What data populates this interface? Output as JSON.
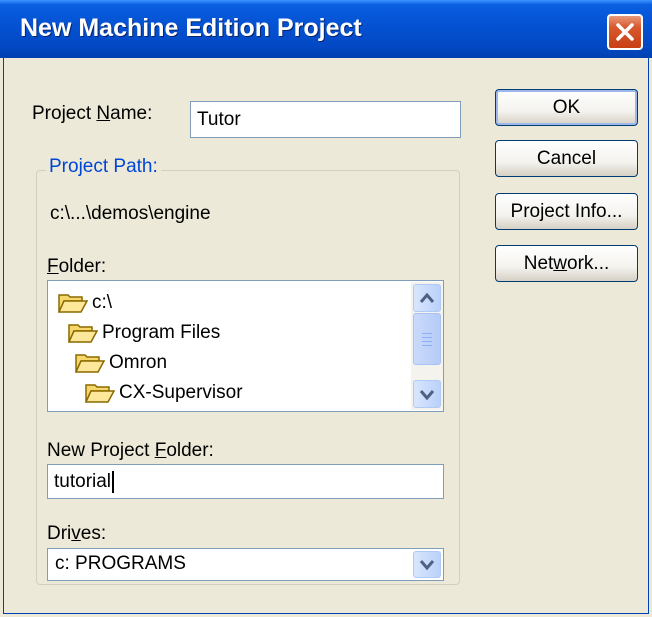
{
  "window": {
    "title": "New Machine Edition Project"
  },
  "project_name": {
    "label_before": "Project ",
    "label_mnemonic": "N",
    "label_after": "ame:",
    "value": "Tutor"
  },
  "project_path": {
    "group_label": "Project Path:",
    "path": "c:\\...\\demos\\engine"
  },
  "folder": {
    "label_mnemonic": "F",
    "label_after": "older:",
    "items": [
      {
        "label": "c:\\",
        "icon": "open-folder-icon"
      },
      {
        "label": "Program Files",
        "icon": "open-folder-icon"
      },
      {
        "label": "Omron",
        "icon": "open-folder-icon"
      },
      {
        "label": "CX-Supervisor",
        "icon": "open-folder-icon"
      }
    ]
  },
  "new_project_folder": {
    "label_before": "New Project ",
    "label_mnemonic": "F",
    "label_after": "older:",
    "value": "tutorial"
  },
  "drives": {
    "label_before": "Dri",
    "label_mnemonic": "v",
    "label_after": "es:",
    "selected": "c: PROGRAMS"
  },
  "buttons": {
    "ok": "OK",
    "cancel": "Cancel",
    "project_info": "Project Info...",
    "network_before": "Net",
    "network_mnemonic": "w",
    "network_after": "ork..."
  },
  "colors": {
    "title_bar": "#0453D4",
    "dialog_face": "#ECE9D8",
    "group_label": "#0046D5",
    "close_button": "#D9582D"
  },
  "icons": [
    "close-icon",
    "open-folder-icon",
    "scroll-up-arrow-icon",
    "scroll-down-arrow-icon",
    "dropdown-arrow-icon"
  ]
}
